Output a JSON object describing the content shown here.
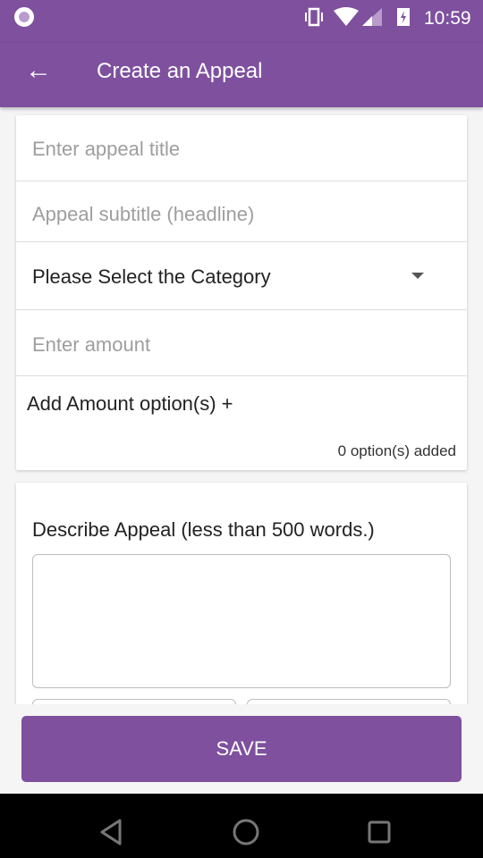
{
  "status": {
    "time": "10:59"
  },
  "toolbar": {
    "title": "Create an Appeal"
  },
  "form": {
    "title_placeholder": "Enter appeal title",
    "subtitle_placeholder": "Appeal subtitle (headline)",
    "category": "Please Select the Category",
    "amount_placeholder": "Enter amount",
    "add_amount_label": "Add Amount option(s) +",
    "options_count": "0 option(s) added",
    "describe_label": "Describe Appeal (less than 500 words.)"
  },
  "save_label": "SAVE",
  "colors": {
    "primary": "#7e509e"
  }
}
